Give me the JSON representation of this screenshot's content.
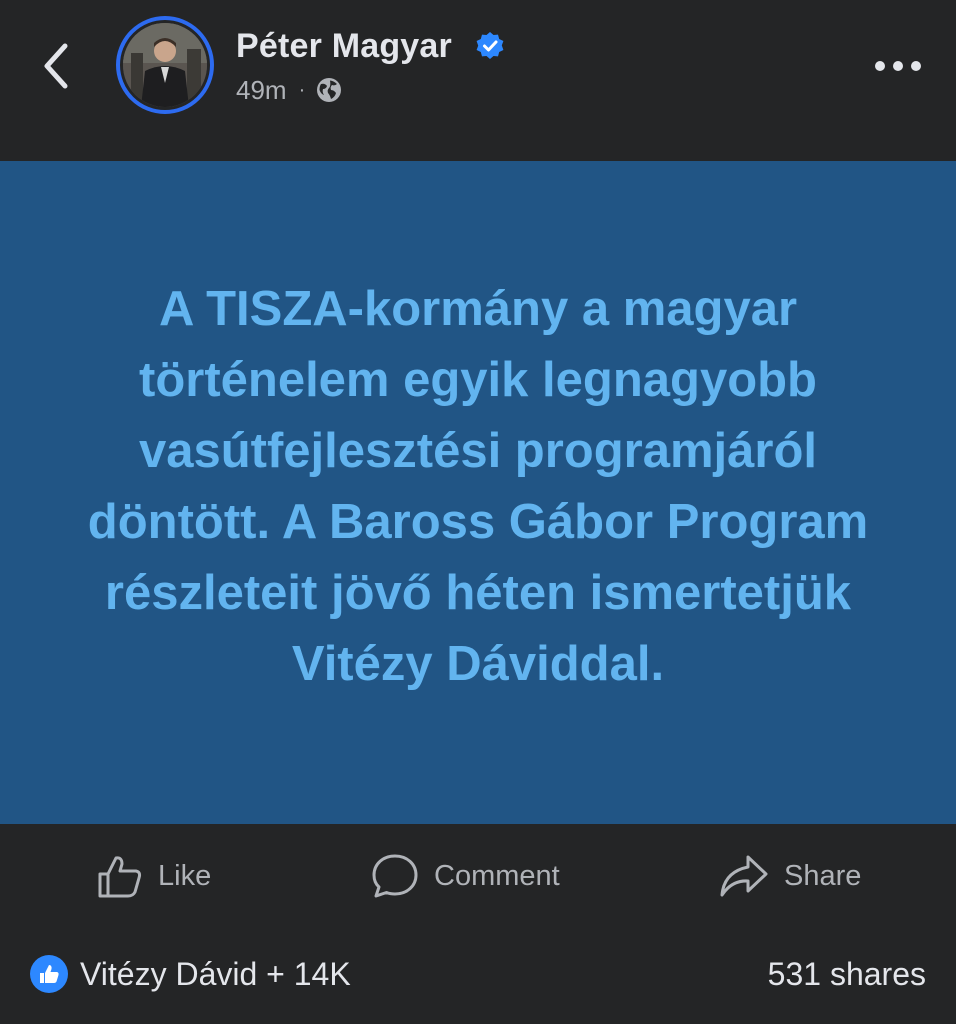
{
  "header": {
    "author_name": "Péter Magyar",
    "timestamp": "49m",
    "separator": "·",
    "icons": {
      "back": "chevron-left-icon",
      "verified": "verified-badge-icon",
      "audience": "globe-icon",
      "more": "more-horizontal-icon"
    }
  },
  "post": {
    "text": "A TISZA-kormány a magyar történelem egyik legnagyobb vasútfejlesztési programjáról döntött. A Baross Gábor Program részleteit jövő héten ismertetjük Vitézy Dáviddal.",
    "background_color": "#215585",
    "text_color": "#62b4ef"
  },
  "actions": {
    "like_label": "Like",
    "comment_label": "Comment",
    "share_label": "Share"
  },
  "footer": {
    "reactions_text": "Vitézy Dávid + 14K",
    "shares_text": "531 shares"
  },
  "colors": {
    "background": "#242526",
    "accent": "#2d88ff",
    "secondary_text": "#b0b3b8"
  }
}
